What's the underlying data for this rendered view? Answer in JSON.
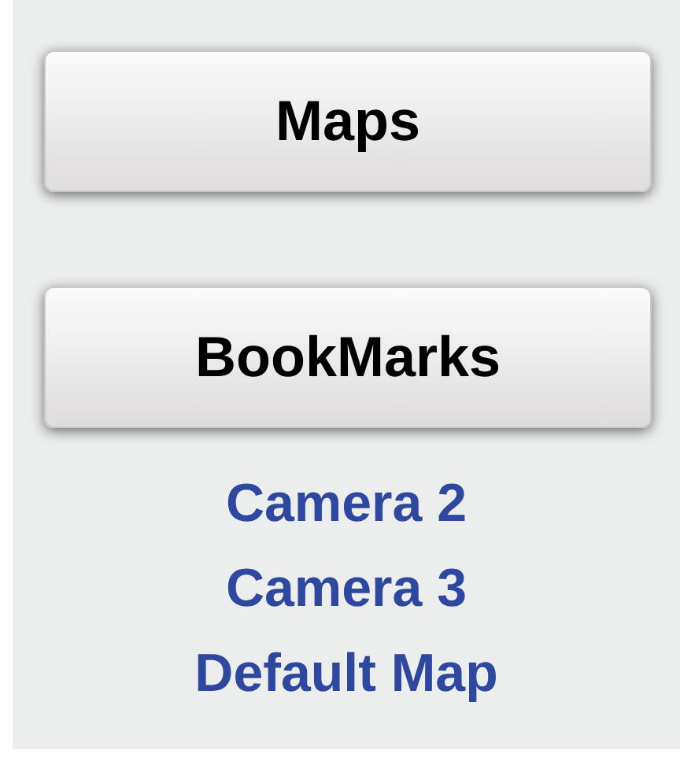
{
  "buttons": [
    {
      "label": "Maps"
    },
    {
      "label": "BookMarks"
    }
  ],
  "links": [
    {
      "label": "Camera 2"
    },
    {
      "label": "Camera 3"
    },
    {
      "label": "Default Map"
    }
  ]
}
